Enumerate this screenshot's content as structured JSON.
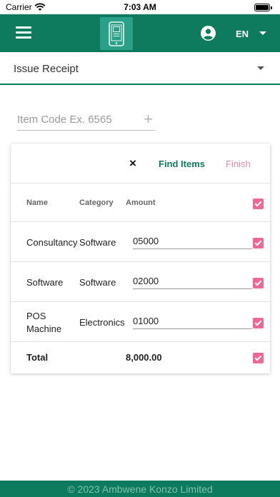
{
  "status_bar": {
    "carrier": "Carrier",
    "time": "7:03 AM"
  },
  "app_bar": {
    "language": "EN"
  },
  "receipt_type": {
    "selected": "Issue Receipt"
  },
  "item_code": {
    "placeholder": "Item Code Ex. 6565",
    "value": "",
    "add_symbol": "+"
  },
  "items_panel": {
    "close_symbol": "×",
    "find_label": "Find Items",
    "finish_label": "Finish",
    "columns": {
      "name": "Name",
      "category": "Category",
      "amount": "Amount"
    },
    "rows": [
      {
        "name": "Consultancy",
        "category": "Software",
        "amount": "05000",
        "checked": true
      },
      {
        "name": "Software",
        "category": "Software",
        "amount": "02000",
        "checked": true
      },
      {
        "name": "POS Machine",
        "category": "Electronics",
        "amount": "01000",
        "checked": true
      }
    ],
    "total": {
      "label": "Total",
      "value": "8,000.00",
      "checked": true
    }
  },
  "footer": {
    "text": "© 2023 Ambwene Konzo Limited"
  },
  "colors": {
    "primary": "#0e7a5e",
    "accent_pink": "#f06694",
    "finish_pink": "#e88aa6"
  },
  "icons": {
    "menu": "hamburger-icon",
    "profile": "account-circle-icon",
    "logo": "phone-receipt-logo",
    "checkbox": "checkbox-checked-icon"
  }
}
